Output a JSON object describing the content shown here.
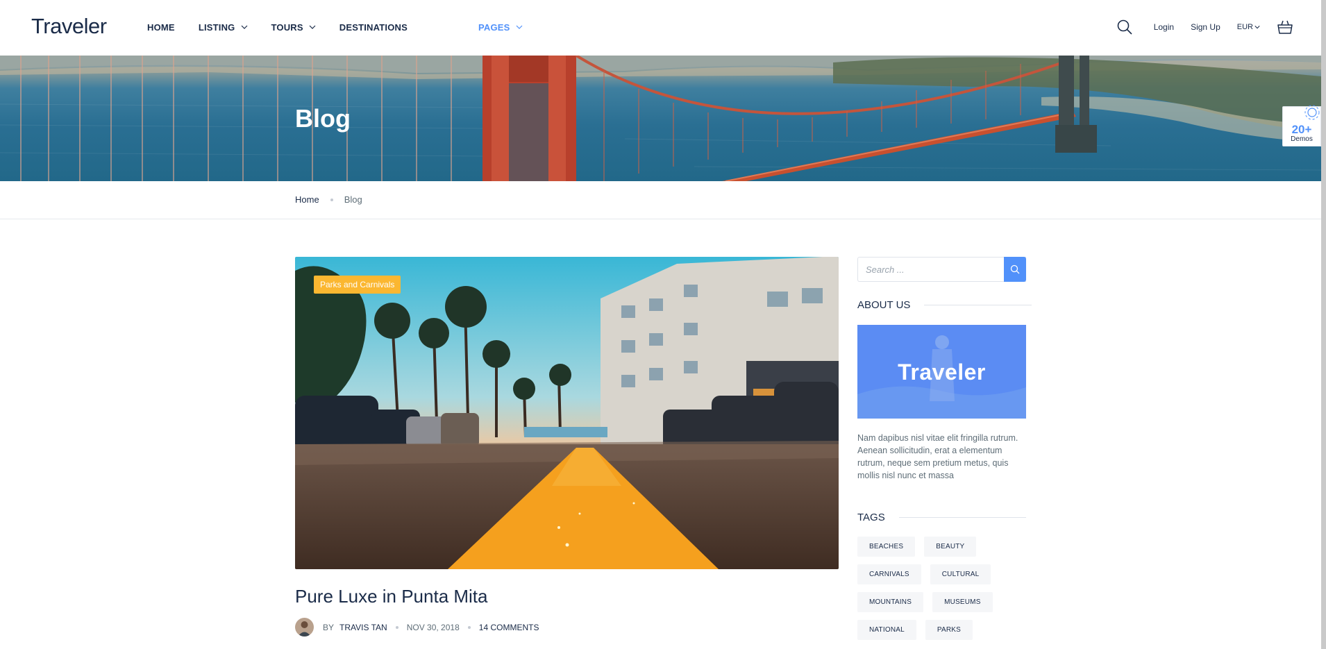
{
  "header": {
    "logo": "Traveler",
    "nav": [
      {
        "label": "HOME",
        "has_dropdown": false,
        "active": false
      },
      {
        "label": "LISTING",
        "has_dropdown": true,
        "active": false
      },
      {
        "label": "TOURS",
        "has_dropdown": true,
        "active": false
      },
      {
        "label": "DESTINATIONS",
        "has_dropdown": false,
        "active": false
      },
      {
        "label": "PAGES",
        "has_dropdown": true,
        "active": true
      }
    ],
    "login": "Login",
    "signup": "Sign Up",
    "currency": "EUR",
    "icons": [
      "search-icon",
      "chevron-down-icon",
      "basket-icon"
    ]
  },
  "banner": {
    "title": "Blog",
    "demos_count": "20+",
    "demos_label": "Demos"
  },
  "breadcrumb": {
    "home": "Home",
    "current": "Blog"
  },
  "post": {
    "category": "Parks and Carnivals",
    "title": "Pure Luxe in Punta Mita",
    "by": "BY",
    "author": "TRAVIS TAN",
    "date": "NOV 30, 2018",
    "comments": "14 COMMENTS"
  },
  "sidebar": {
    "search_placeholder": "Search ...",
    "about_title": "ABOUT US",
    "about_logo": "Traveler",
    "about_text": "Nam dapibus nisl vitae elit fringilla rutrum. Aenean sollicitudin, erat a elementum rutrum, neque sem pretium metus, quis mollis nisl nunc et massa",
    "tags_title": "TAGS",
    "tags": [
      "BEACHES",
      "BEAUTY",
      "CARNIVALS",
      "CULTURAL",
      "MOUNTAINS",
      "MUSEUMS",
      "NATIONAL",
      "PARKS"
    ]
  },
  "colors": {
    "primary": "#5191fa",
    "text_dark": "#1a2b48",
    "text_muted": "#5e6d77",
    "badge": "#fbb731"
  }
}
